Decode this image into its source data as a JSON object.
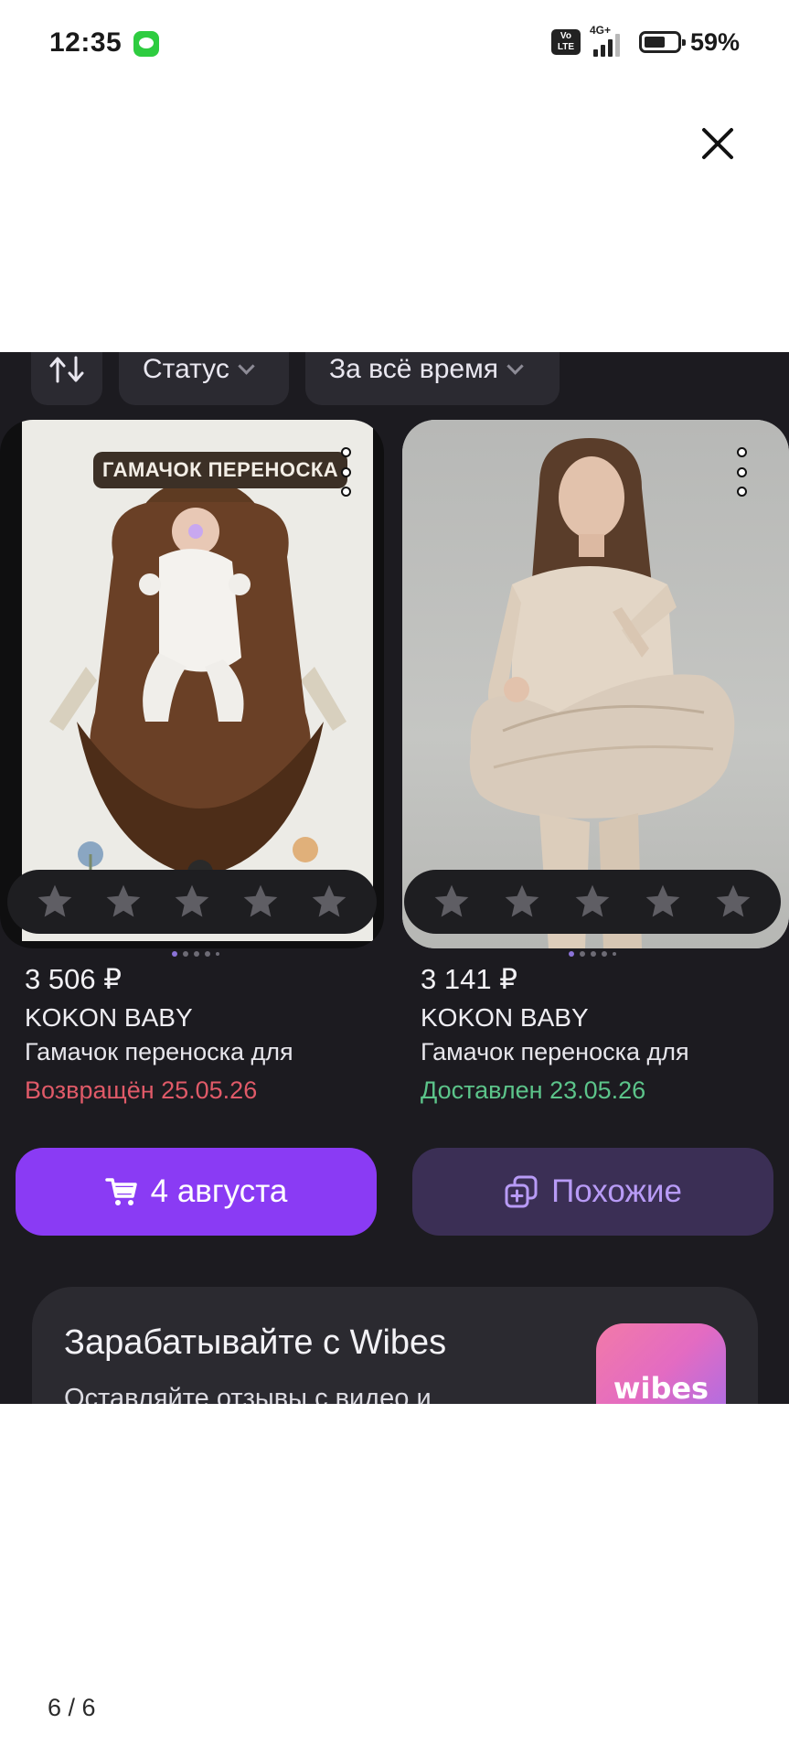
{
  "status_bar": {
    "time": "12:35",
    "message_icon": "message-bubble-icon",
    "network_label": "4G+",
    "volte_label": "Vo LTE",
    "battery": "59%"
  },
  "close_icon": "close-icon",
  "filters": {
    "sort_icon": "sort-arrows-icon",
    "status_label": "Статус",
    "period_label": "За всё время"
  },
  "products": [
    {
      "tag": "ГАМАЧОК ПЕРЕНОСКА",
      "price": "3 506 ₽",
      "brand": "KOKON BABY",
      "name": "Гамачок переноска для",
      "status": "Возвращён 25.05.26",
      "status_color": "#e05a68"
    },
    {
      "tag": "",
      "price": "3 141 ₽",
      "brand": "KOKON BABY",
      "name": "Гамачок переноска для",
      "status": "Доставлен 23.05.26",
      "status_color": "#5cc48a"
    }
  ],
  "buttons": {
    "cart_label": "4 августа",
    "similar_label": "Похожие"
  },
  "promo": {
    "title": "Зарабатывайте с Wibes",
    "subtitle": "Оставляйте отзывы с видео и",
    "logo_text": "wibes"
  },
  "pager": "6 / 6",
  "colors": {
    "accent_purple": "#8a3bf4",
    "similar_bg": "#3b2f55",
    "dark_bg": "#1c1b20"
  }
}
